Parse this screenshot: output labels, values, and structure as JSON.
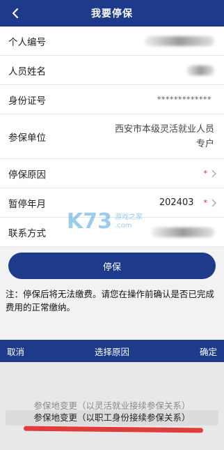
{
  "header": {
    "title": "我要停保"
  },
  "form": {
    "id_no": {
      "label": "个人编号"
    },
    "name": {
      "label": "人员姓名"
    },
    "id_card": {
      "label": "身份证号",
      "masked_value": "*************"
    },
    "unit": {
      "label": "参保单位",
      "value_line1": "西安市本级灵活就业人员",
      "value_line2": "专户"
    },
    "reason": {
      "label": "停保原因",
      "required_mark": "*"
    },
    "month": {
      "label": "暂停年月",
      "value": "202403",
      "required_mark": "*"
    },
    "contact": {
      "label": "联系方式"
    }
  },
  "watermark": {
    "logo": "K73",
    "text1": "游戏之家",
    "text2": ".com"
  },
  "submit": {
    "label": "停保"
  },
  "note": {
    "text": "注：停保后将无法缴费。请您在操作前确认是否已完成费用的正常缴纳。"
  },
  "picker": {
    "cancel": "取消",
    "title": "选择原因",
    "confirm": "确定",
    "options": [
      "参保地变更（以灵活就业接续参保关系）",
      "参保地变更（以职工身份接续参保关系）"
    ],
    "selected_index": 1
  },
  "colors": {
    "primary": "#1e3a8a",
    "required": "#e11d48",
    "annotation": "#e23b3b"
  }
}
